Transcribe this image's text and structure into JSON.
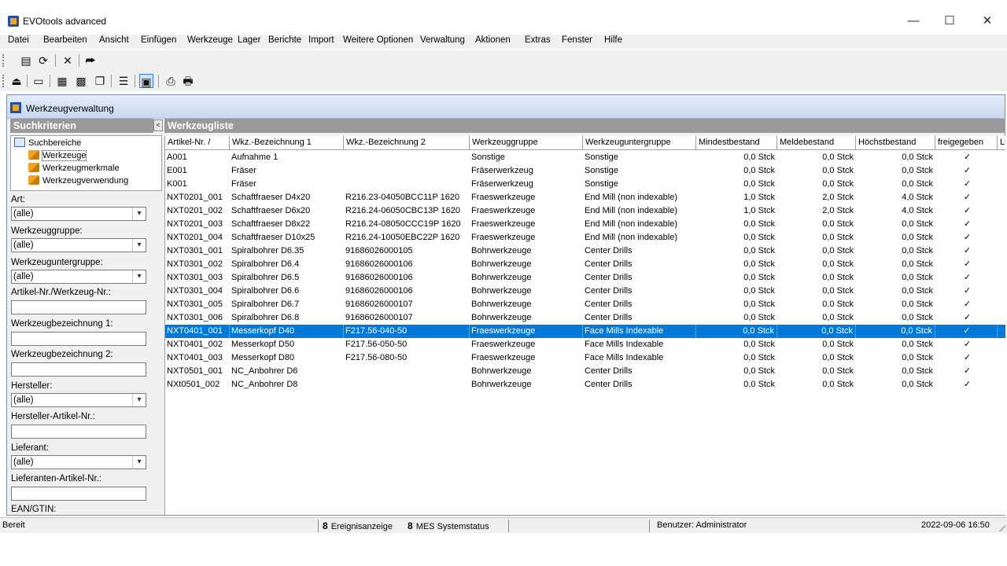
{
  "window": {
    "title": "EVOtools advanced",
    "minimize": "—",
    "maximize": "☐",
    "close": "✕"
  },
  "menu": [
    "Datei",
    "Bearbeiten",
    "Ansicht",
    "Einfügen",
    "Werkzeuge",
    "Lager",
    "Berichte",
    "Import",
    "Weitere Optionen",
    "Verwaltung",
    "Aktionen",
    "Extras",
    "Fenster",
    "Hilfe"
  ],
  "toolbar1": {
    "icons": [
      "folder-report-icon",
      "refresh-icon",
      "close-icon",
      "exit-icon"
    ],
    "glyphs": [
      "▤",
      "⟳",
      "✕",
      "⮫"
    ]
  },
  "toolbar2": {
    "icons": [
      "export-icon",
      "folder-open-icon",
      "view-1-icon",
      "view-2-icon",
      "copy-icon",
      "list-icon",
      "panel-icon",
      "preview-icon",
      "print-icon"
    ],
    "glyphs": [
      "⏏",
      "▭",
      "▦",
      "▩",
      "❐",
      "☰",
      "▣",
      "⎙",
      "🖶"
    ]
  },
  "subwindow": {
    "title": "Werkzeugverwaltung"
  },
  "search_panel": {
    "header": "Suchkriterien",
    "collapse": "<",
    "tree": {
      "root": "Suchbereiche",
      "children": [
        "Werkzeuge",
        "Werkzeugmerkmale",
        "Werkzeugverwendung"
      ]
    },
    "fields": {
      "art_label": "Art:",
      "art_value": "(alle)",
      "gruppe_label": "Werkzeuggruppe:",
      "gruppe_value": "(alle)",
      "untergruppe_label": "Werkzeuguntergruppe:",
      "untergruppe_value": "(alle)",
      "artikelnr_label": "Artikel-Nr./Werkzeug-Nr.:",
      "bez1_label": "Werkzeugbezeichnung 1:",
      "bez2_label": "Werkzeugbezeichnung 2:",
      "hersteller_label": "Hersteller:",
      "hersteller_value": "(alle)",
      "hersteller_art_label": "Hersteller-Artikel-Nr.:",
      "lieferant_label": "Lieferant:",
      "lieferant_value": "(alle)",
      "lieferant_art_label": "Lieferanten-Artikel-Nr.:",
      "ean_label": "EAN/GTIN:"
    }
  },
  "list_panel": {
    "header": "Werkzeugliste",
    "columns": [
      "Artikel-Nr.   /",
      "Wkz.-Bezeichnung 1",
      "Wkz.-Bezeichnung 2",
      "Werkzeuggruppe",
      "Werkzeuguntergruppe",
      "Mindestbestand",
      "Meldebestand",
      "Höchstbestand",
      "freigegeben",
      "Li"
    ],
    "rows": [
      [
        "A001",
        "Aufnahme 1",
        "",
        "Sonstige",
        "Sonstige",
        "0,0 Stck",
        "0,0 Stck",
        "0,0 Stck",
        "✓"
      ],
      [
        "E001",
        "Fräser",
        "",
        "Fräserwerkzeug",
        "Sonstige",
        "0,0 Stck",
        "0,0 Stck",
        "0,0 Stck",
        "✓"
      ],
      [
        "K001",
        "Fräser",
        "",
        "Fräserwerkzeug",
        "Sonstige",
        "0,0 Stck",
        "0,0 Stck",
        "0,0 Stck",
        "✓"
      ],
      [
        "NXT0201_001",
        "Schaftfraeser D4x20",
        "R216.23-04050BCC11P 1620",
        "Fraeswerkzeuge",
        "End Mill (non indexable)",
        "1,0 Stck",
        "2,0 Stck",
        "4,0 Stck",
        "✓"
      ],
      [
        "NXT0201_002",
        "Schaftfraeser D6x20",
        "R216.24-06050CBC13P 1620",
        "Fraeswerkzeuge",
        "End Mill (non indexable)",
        "1,0 Stck",
        "2,0 Stck",
        "4,0 Stck",
        "✓"
      ],
      [
        "NXT0201_003",
        "Schaftfraeser D8x22",
        "R216.24-08050CCC19P 1620",
        "Fraeswerkzeuge",
        "End Mill (non indexable)",
        "0,0 Stck",
        "0,0 Stck",
        "0,0 Stck",
        "✓"
      ],
      [
        "NXT0201_004",
        "Schaftfraeser D10x25",
        "R216.24-10050EBC22P 1620",
        "Fraeswerkzeuge",
        "End Mill (non indexable)",
        "0,0 Stck",
        "0,0 Stck",
        "0,0 Stck",
        "✓"
      ],
      [
        "NXT0301_001",
        "Spiralbohrer D6.35",
        "91686026000105",
        "Bohrwerkzeuge",
        "Center Drills",
        "0,0 Stck",
        "0,0 Stck",
        "0,0 Stck",
        "✓"
      ],
      [
        "NXT0301_002",
        "Spiralbohrer D6.4",
        "91686026000106",
        "Bohrwerkzeuge",
        "Center Drills",
        "0,0 Stck",
        "0,0 Stck",
        "0,0 Stck",
        "✓"
      ],
      [
        "NXT0301_003",
        "Spiralbohrer D6.5",
        "91686026000106",
        "Bohrwerkzeuge",
        "Center Drills",
        "0,0 Stck",
        "0,0 Stck",
        "0,0 Stck",
        "✓"
      ],
      [
        "NXT0301_004",
        "Spiralbohrer D6.6",
        "91686026000106",
        "Bohrwerkzeuge",
        "Center Drills",
        "0,0 Stck",
        "0,0 Stck",
        "0,0 Stck",
        "✓"
      ],
      [
        "NXT0301_005",
        "Spiralbohrer D6.7",
        "91686026000107",
        "Bohrwerkzeuge",
        "Center Drills",
        "0,0 Stck",
        "0,0 Stck",
        "0,0 Stck",
        "✓"
      ],
      [
        "NXT0301_006",
        "Spiralbohrer D6.8",
        "91686026000107",
        "Bohrwerkzeuge",
        "Center Drills",
        "0,0 Stck",
        "0,0 Stck",
        "0,0 Stck",
        "✓"
      ],
      [
        "NXT0401_001",
        "Messerkopf D40",
        "F217.56-040-50",
        "Fraeswerkzeuge",
        "Face Mills Indexable",
        "0,0 Stck",
        "0,0 Stck",
        "0,0 Stck",
        "✓"
      ],
      [
        "NXT0401_002",
        "Messerkopf D50",
        "F217.56-050-50",
        "Fraeswerkzeuge",
        "Face Mills Indexable",
        "0,0 Stck",
        "0,0 Stck",
        "0,0 Stck",
        "✓"
      ],
      [
        "NXT0401_003",
        "Messerkopf D80",
        "F217.56-080-50",
        "Fraeswerkzeuge",
        "Face Mills Indexable",
        "0,0 Stck",
        "0,0 Stck",
        "0,0 Stck",
        "✓"
      ],
      [
        "NXT0501_001",
        "NC_Anbohrer D6",
        "",
        "Bohrwerkzeuge",
        "Center Drills",
        "0,0 Stck",
        "0,0 Stck",
        "0,0 Stck",
        "✓"
      ],
      [
        "NXt0501_002",
        "NC_Anbohrer D8",
        "",
        "Bohrwerkzeuge",
        "Center Drills",
        "0,0 Stck",
        "0,0 Stck",
        "0,0 Stck",
        "✓"
      ]
    ],
    "selected_row": 13
  },
  "status": {
    "ready": "Bereit",
    "event_icon": "8",
    "events": "Ereignisanzeige",
    "mes_icon": "8",
    "mes": "MES Systemstatus",
    "user": "Benutzer: Administrator",
    "datetime": "2022-09-06 16:50"
  },
  "colors": {
    "selection": "#0078d7",
    "panel_header": "#9a9a9a"
  }
}
